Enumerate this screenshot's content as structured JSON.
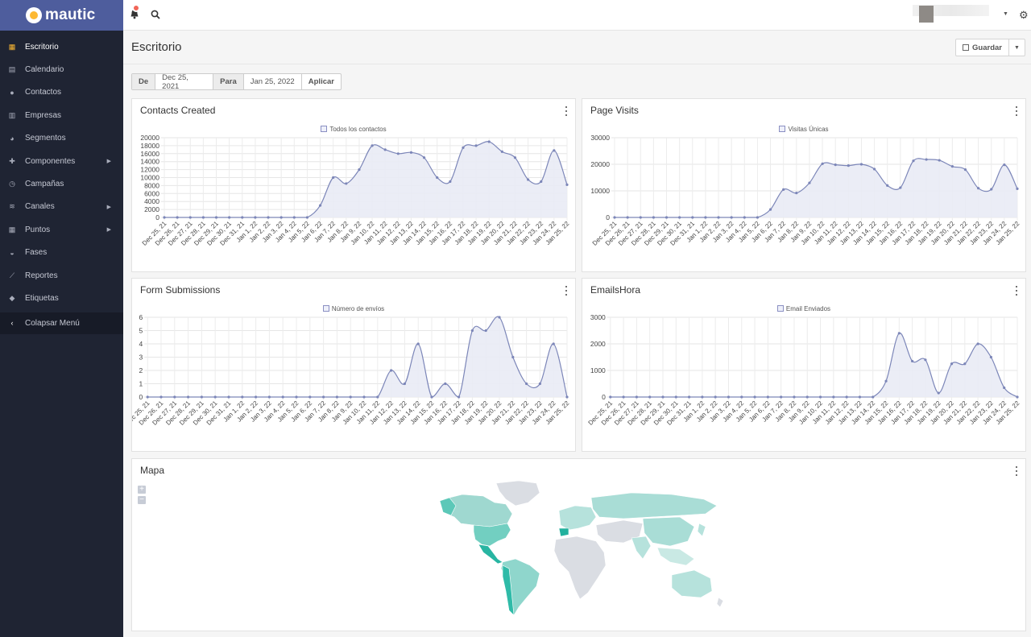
{
  "app": {
    "logo_text": "mautic"
  },
  "sidebar": {
    "items": [
      {
        "label": "Escritorio",
        "icon": "grid-icon",
        "active": true,
        "submenu": false
      },
      {
        "label": "Calendario",
        "icon": "calendar-icon",
        "active": false,
        "submenu": false
      },
      {
        "label": "Contactos",
        "icon": "user-icon",
        "active": false,
        "submenu": false
      },
      {
        "label": "Empresas",
        "icon": "building-icon",
        "active": false,
        "submenu": false
      },
      {
        "label": "Segmentos",
        "icon": "pie-chart-icon",
        "active": false,
        "submenu": false
      },
      {
        "label": "Componentes",
        "icon": "puzzle-icon",
        "active": false,
        "submenu": true
      },
      {
        "label": "Campañas",
        "icon": "clock-icon",
        "active": false,
        "submenu": false
      },
      {
        "label": "Canales",
        "icon": "rss-icon",
        "active": false,
        "submenu": true
      },
      {
        "label": "Puntos",
        "icon": "calculator-icon",
        "active": false,
        "submenu": true
      },
      {
        "label": "Fases",
        "icon": "tachometer-icon",
        "active": false,
        "submenu": false
      },
      {
        "label": "Reportes",
        "icon": "line-chart-icon",
        "active": false,
        "submenu": false
      },
      {
        "label": "Etiquetas",
        "icon": "tag-icon",
        "active": false,
        "submenu": false
      }
    ],
    "collapse_label": "Colapsar Menú"
  },
  "header": {
    "title": "Escritorio",
    "save_label": "Guardar"
  },
  "filter": {
    "from_label": "De",
    "from_value": "Dec 25, 2021",
    "to_label": "Para",
    "to_value": "Jan 25, 2022",
    "apply_label": "Aplicar"
  },
  "colors": {
    "accent": "#4e5d9d",
    "sidebar_bg": "#1f2433",
    "line": "#7c86b8",
    "fill": "#e9ebf5",
    "map_teal": "#3fbfae"
  },
  "chart_data": [
    {
      "type": "area",
      "title": "Contacts Created",
      "legend": "Todos los contactos",
      "ylim": [
        0,
        20000
      ],
      "yticks": [
        0,
        2000,
        4000,
        6000,
        8000,
        10000,
        12000,
        14000,
        16000,
        18000,
        20000
      ],
      "categories": [
        "Dec 25, 21",
        "Dec 26, 21",
        "Dec 27, 21",
        "Dec 28, 21",
        "Dec 29, 21",
        "Dec 30, 21",
        "Dec 31, 21",
        "Jan 1, 22",
        "Jan 2, 22",
        "Jan 3, 22",
        "Jan 4, 22",
        "Jan 5, 22",
        "Jan 6, 22",
        "Jan 7, 22",
        "Jan 8, 22",
        "Jan 9, 22",
        "Jan 10, 22",
        "Jan 11, 22",
        "Jan 12, 22",
        "Jan 13, 22",
        "Jan 14, 22",
        "Jan 15, 22",
        "Jan 16, 22",
        "Jan 17, 22",
        "Jan 18, 22",
        "Jan 19, 22",
        "Jan 20, 22",
        "Jan 21, 22",
        "Jan 22, 22",
        "Jan 23, 22",
        "Jan 24, 22",
        "Jan 25, 22"
      ],
      "values": [
        0,
        0,
        0,
        0,
        0,
        0,
        0,
        0,
        0,
        0,
        0,
        0,
        3000,
        10000,
        8500,
        12000,
        18000,
        17000,
        16000,
        16300,
        15000,
        10000,
        9000,
        17500,
        18000,
        19000,
        16500,
        15000,
        9500,
        9000,
        16800,
        8200
      ]
    },
    {
      "type": "area",
      "title": "Page Visits",
      "legend": "Visitas Únicas",
      "ylim": [
        0,
        30000
      ],
      "yticks": [
        0,
        10000,
        20000,
        30000
      ],
      "categories": [
        "Dec 25, 21",
        "Dec 26, 21",
        "Dec 27, 21",
        "Dec 28, 21",
        "Dec 29, 21",
        "Dec 30, 21",
        "Dec 31, 21",
        "Jan 1, 22",
        "Jan 2, 22",
        "Jan 3, 22",
        "Jan 4, 22",
        "Jan 5, 22",
        "Jan 6, 22",
        "Jan 7, 22",
        "Jan 8, 22",
        "Jan 9, 22",
        "Jan 10, 22",
        "Jan 11, 22",
        "Jan 12, 22",
        "Jan 13, 22",
        "Jan 14, 22",
        "Jan 15, 22",
        "Jan 16, 22",
        "Jan 17, 22",
        "Jan 18, 22",
        "Jan 19, 22",
        "Jan 20, 22",
        "Jan 21, 22",
        "Jan 22, 22",
        "Jan 23, 22",
        "Jan 24, 22",
        "Jan 25, 22"
      ],
      "values": [
        0,
        0,
        0,
        0,
        0,
        0,
        0,
        0,
        0,
        0,
        0,
        0,
        3000,
        10500,
        9200,
        13000,
        20200,
        19800,
        19500,
        20000,
        18200,
        12000,
        11200,
        21300,
        21800,
        21500,
        19200,
        18000,
        11000,
        10600,
        19800,
        10800
      ]
    },
    {
      "type": "area",
      "title": "Form Submissions",
      "legend": "Número de envíos",
      "ylim": [
        0,
        6
      ],
      "yticks": [
        0,
        1,
        2,
        3,
        4,
        5,
        6
      ],
      "categories": [
        "Dec 25, 21",
        "Dec 26, 21",
        "Dec 27, 21",
        "Dec 28, 21",
        "Dec 29, 21",
        "Dec 30, 21",
        "Dec 31, 21",
        "Jan 1, 22",
        "Jan 2, 22",
        "Jan 3, 22",
        "Jan 4, 22",
        "Jan 5, 22",
        "Jan 6, 22",
        "Jan 7, 22",
        "Jan 8, 22",
        "Jan 9, 22",
        "Jan 10, 22",
        "Jan 11, 22",
        "Jan 12, 22",
        "Jan 13, 22",
        "Jan 14, 22",
        "Jan 15, 22",
        "Jan 16, 22",
        "Jan 17, 22",
        "Jan 18, 22",
        "Jan 19, 22",
        "Jan 20, 22",
        "Jan 21, 22",
        "Jan 22, 22",
        "Jan 23, 22",
        "Jan 24, 22",
        "Jan 25, 22"
      ],
      "values": [
        0,
        0,
        0,
        0,
        0,
        0,
        0,
        0,
        0,
        0,
        0,
        0,
        0,
        0,
        0,
        0,
        0,
        0,
        2,
        1,
        4,
        0,
        1,
        0,
        5,
        5,
        6,
        3,
        1,
        1,
        4,
        0
      ]
    },
    {
      "type": "area",
      "title": "EmailsHora",
      "legend": "Email Enviados",
      "ylim": [
        0,
        3000
      ],
      "yticks": [
        0,
        1000,
        2000,
        3000
      ],
      "categories": [
        "Dec 25, 21",
        "Dec 26, 21",
        "Dec 27, 21",
        "Dec 28, 21",
        "Dec 29, 21",
        "Dec 30, 21",
        "Dec 31, 21",
        "Jan 1, 22",
        "Jan 2, 22",
        "Jan 3, 22",
        "Jan 4, 22",
        "Jan 5, 22",
        "Jan 6, 22",
        "Jan 7, 22",
        "Jan 8, 22",
        "Jan 9, 22",
        "Jan 10, 22",
        "Jan 11, 22",
        "Jan 12, 22",
        "Jan 13, 22",
        "Jan 14, 22",
        "Jan 15, 22",
        "Jan 16, 22",
        "Jan 17, 22",
        "Jan 18, 22",
        "Jan 19, 22",
        "Jan 20, 22",
        "Jan 21, 22",
        "Jan 22, 22",
        "Jan 23, 22",
        "Jan 24, 22",
        "Jan 25, 22"
      ],
      "values": [
        0,
        0,
        0,
        0,
        0,
        0,
        0,
        0,
        0,
        0,
        0,
        0,
        0,
        0,
        0,
        0,
        0,
        0,
        0,
        0,
        0,
        600,
        2400,
        1350,
        1400,
        150,
        1250,
        1250,
        2000,
        1500,
        350,
        0
      ]
    }
  ],
  "map": {
    "title": "Mapa",
    "zoom_in": "+",
    "zoom_out": "−"
  }
}
